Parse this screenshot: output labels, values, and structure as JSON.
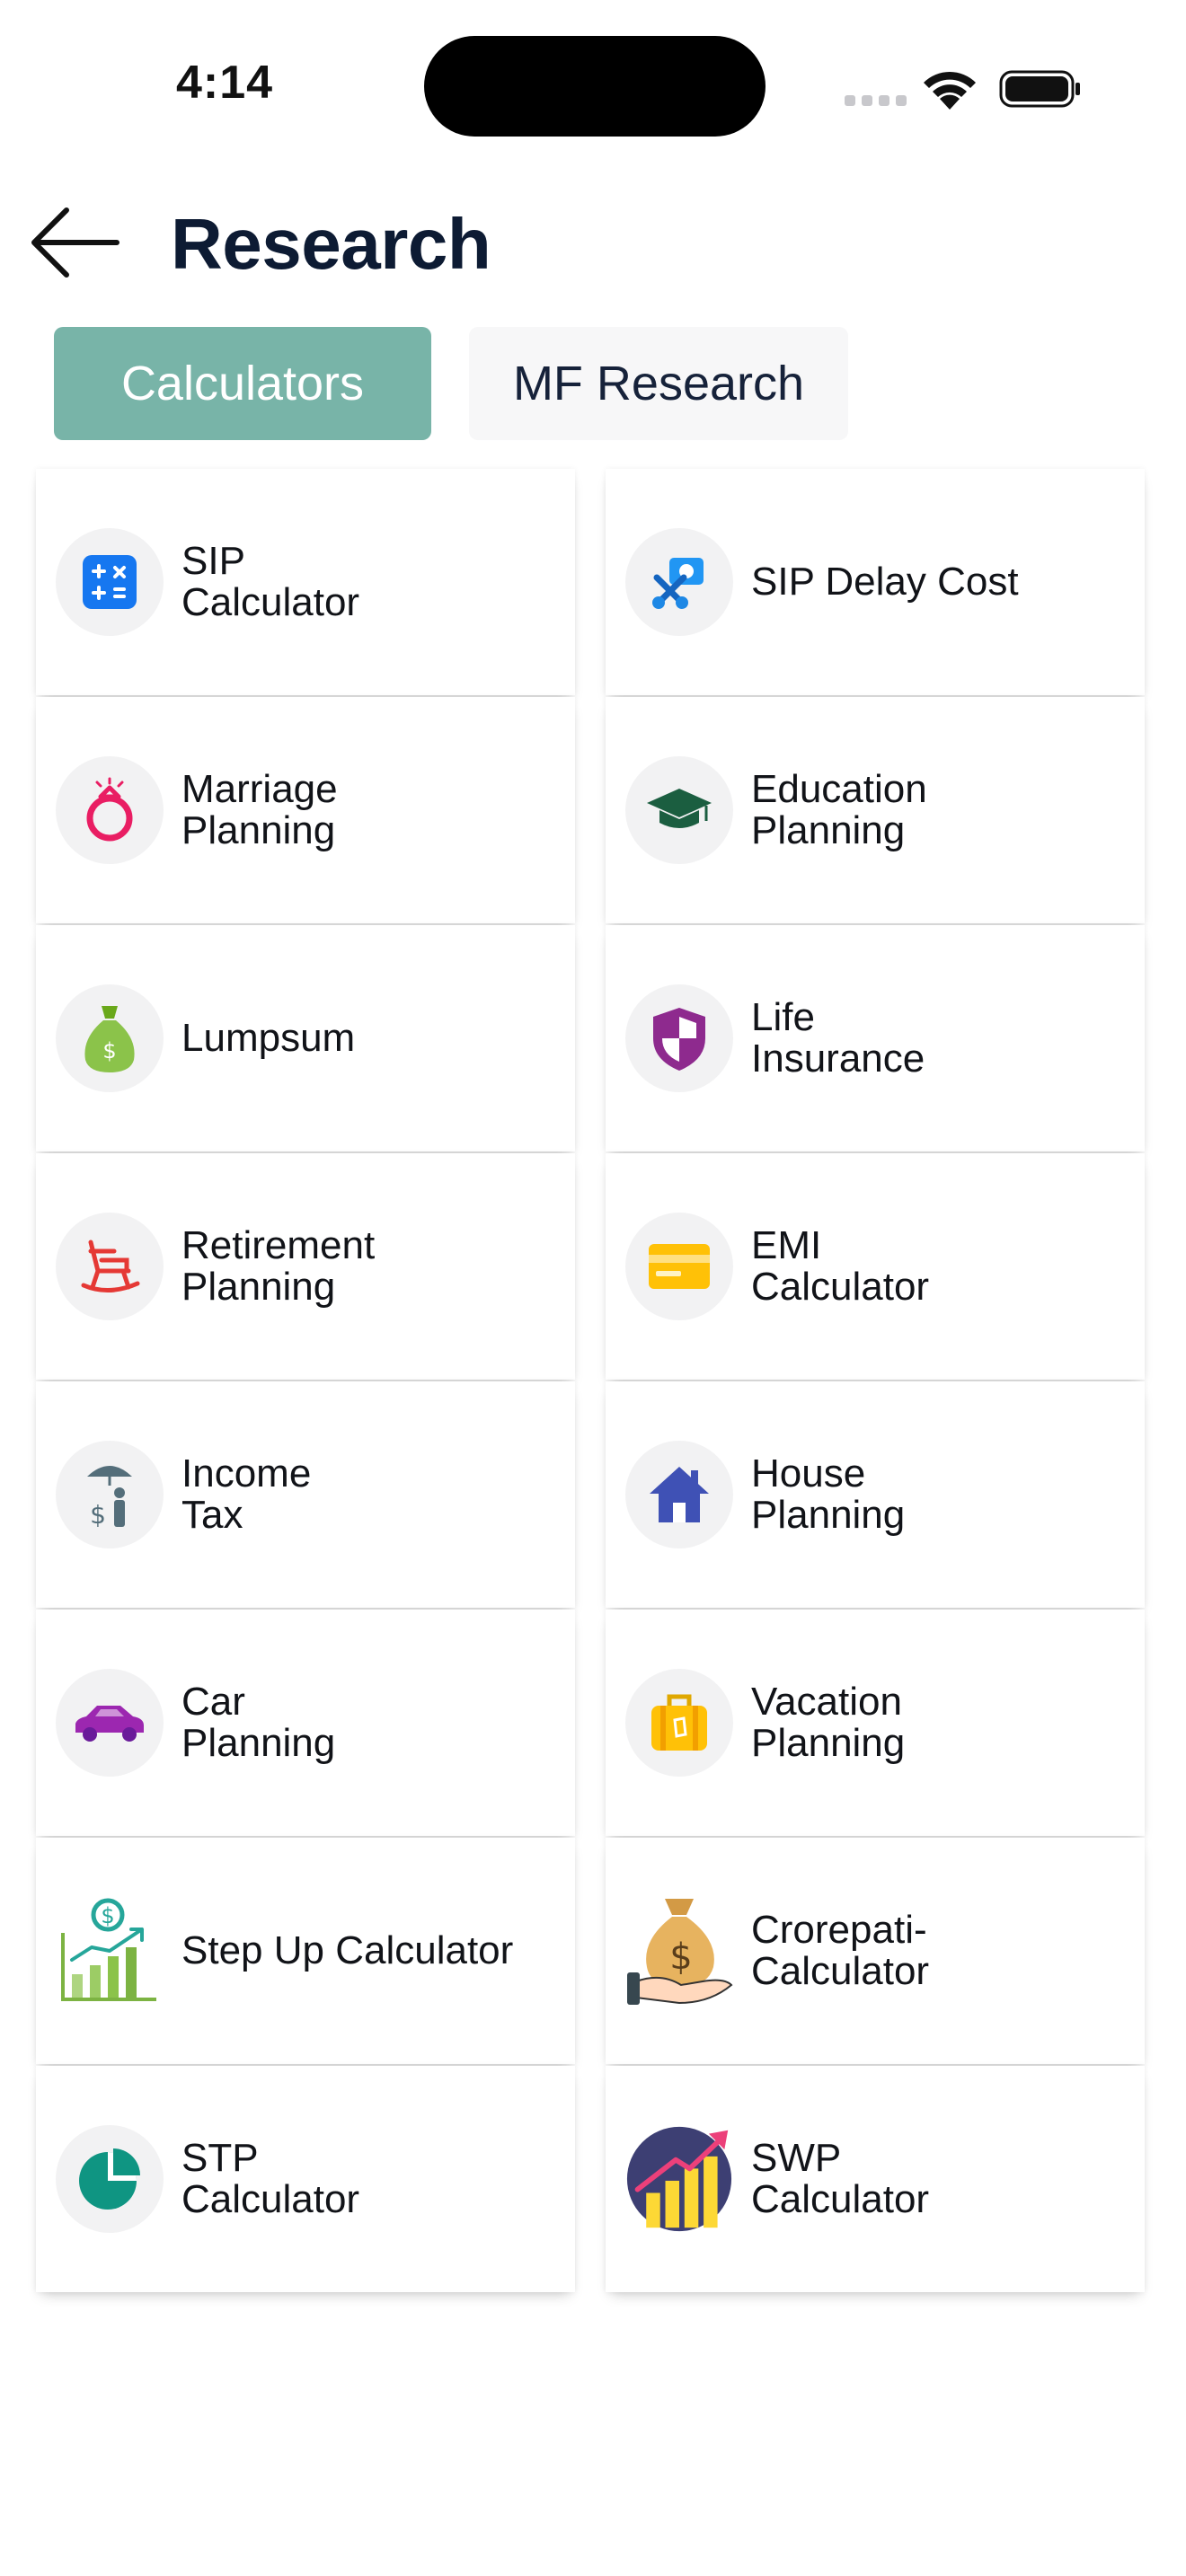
{
  "status_bar": {
    "time": "4:14"
  },
  "header": {
    "title": "Research"
  },
  "tabs": [
    {
      "label": "Calculators",
      "active": true
    },
    {
      "label": "MF Research",
      "active": false
    }
  ],
  "colors": {
    "active_tab": "#78b4a8",
    "title": "#0d1b33",
    "inactive_tab": "#f7f7f8"
  },
  "calculators": [
    {
      "label": "SIP\nCalculator",
      "icon": "calculator-icon"
    },
    {
      "label": "SIP Delay Cost",
      "icon": "delay-cost-icon"
    },
    {
      "label": "Marriage\nPlanning",
      "icon": "ring-icon"
    },
    {
      "label": "Education\nPlanning",
      "icon": "graduation-cap-icon"
    },
    {
      "label": "Lumpsum",
      "icon": "money-bag-icon"
    },
    {
      "label": "Life\nInsurance",
      "icon": "shield-icon"
    },
    {
      "label": "Retirement\nPlanning",
      "icon": "rocking-chair-icon"
    },
    {
      "label": "EMI\nCalculator",
      "icon": "credit-card-icon"
    },
    {
      "label": "Income\nTax",
      "icon": "umbrella-person-icon"
    },
    {
      "label": "House\nPlanning",
      "icon": "house-icon"
    },
    {
      "label": "Car\nPlanning",
      "icon": "car-icon"
    },
    {
      "label": "Vacation\nPlanning",
      "icon": "suitcase-icon"
    },
    {
      "label": "Step Up Calculator",
      "icon": "growth-chart-icon"
    },
    {
      "label": "Crorepati-\nCalculator",
      "icon": "money-bag-hand-icon"
    },
    {
      "label": "STP\nCalculator",
      "icon": "pie-chart-icon"
    },
    {
      "label": "SWP\nCalculator",
      "icon": "bar-chart-arrow-icon"
    }
  ]
}
